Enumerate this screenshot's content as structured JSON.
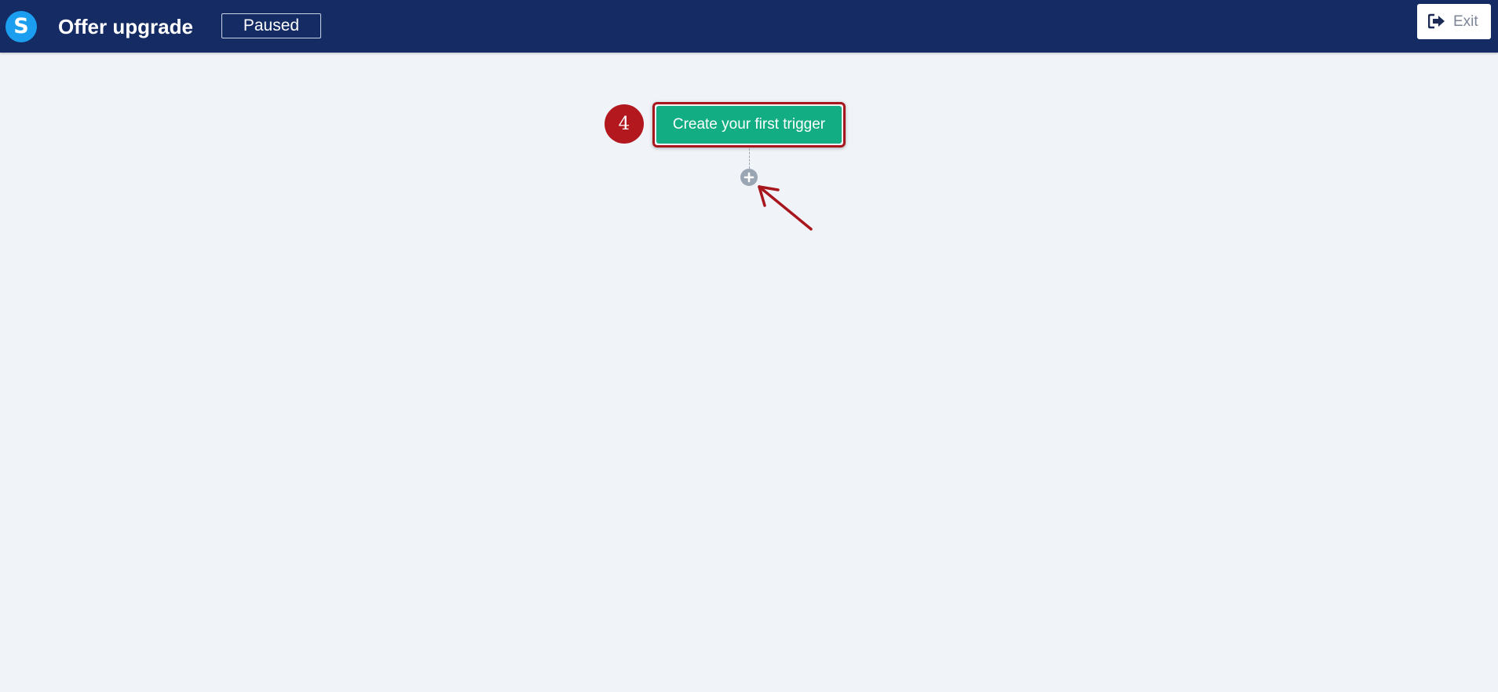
{
  "header": {
    "logo_letter": "S",
    "title": "Offer upgrade",
    "status": "Paused",
    "exit_label": "Exit",
    "exit_icon": "sign-out-icon"
  },
  "canvas": {
    "step_number": "4",
    "trigger_button_label": "Create your first trigger",
    "add_node_icon": "plus-circle-icon",
    "annotation": "arrow-pointer-icon"
  },
  "colors": {
    "header_bg": "#142b63",
    "logo_bg": "#1c9ef0",
    "canvas_bg": "#f0f3f8",
    "trigger_button": "#12ad83",
    "annotation_red": "#b3181f",
    "connector_gray": "#9aa6b4"
  }
}
